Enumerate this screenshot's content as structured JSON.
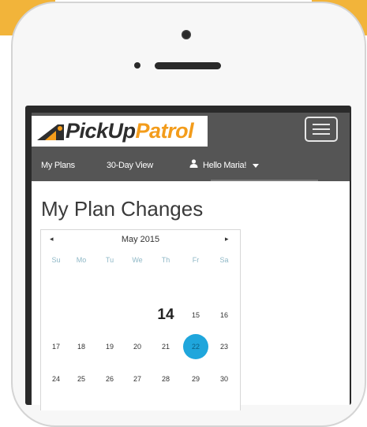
{
  "brand": {
    "part1": "PickUp",
    "part2": "Patrol",
    "accent": "#f39c1b"
  },
  "nav": {
    "items": [
      "My Plans",
      "30-Day View"
    ],
    "user_label": "Hello Maria!",
    "user_icon": "user-icon",
    "menu_icon": "hamburger-menu-icon"
  },
  "page": {
    "title": "My Plan Changes"
  },
  "calendar": {
    "prev": "◂",
    "next": "▸",
    "month": "May 2015",
    "weekdays": [
      "Su",
      "Mo",
      "Tu",
      "We",
      "Th",
      "Fr",
      "Sa"
    ],
    "weeks": [
      [
        "",
        "",
        "",
        "",
        "14",
        "15",
        "16"
      ],
      [
        "17",
        "18",
        "19",
        "20",
        "21",
        "22",
        "23"
      ],
      [
        "24",
        "25",
        "26",
        "27",
        "28",
        "29",
        "30"
      ]
    ],
    "today": "14",
    "selected": "22",
    "selected_color": "#1fa6dc"
  }
}
